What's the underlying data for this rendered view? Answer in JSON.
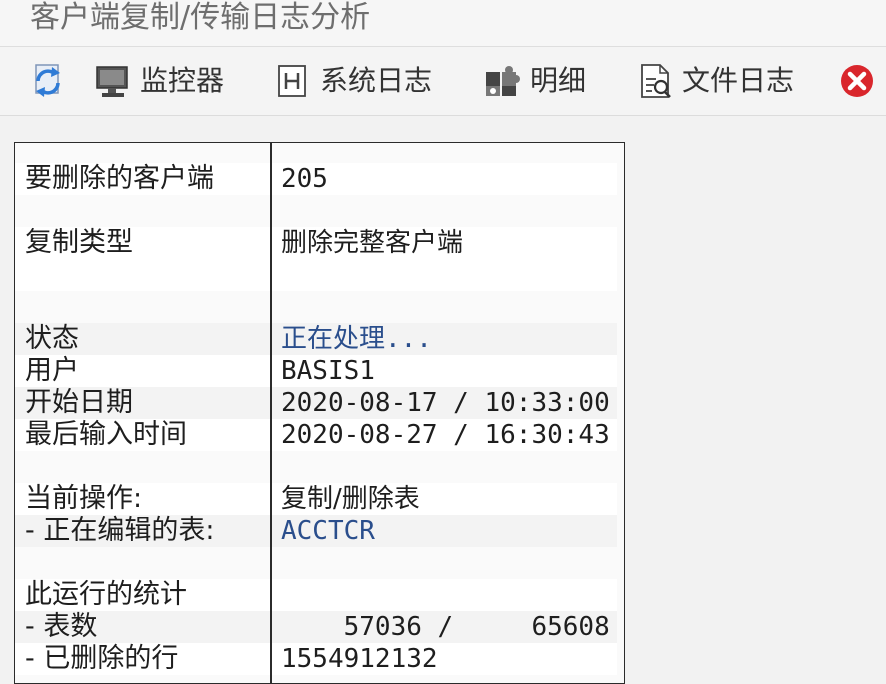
{
  "window": {
    "title": "客户端复制/传输日志分析"
  },
  "toolbar": {
    "refresh_icon": "refresh-icon",
    "monitor_label": "监控器",
    "syslog_label": "系统日志",
    "detail_label": "明细",
    "filelog_label": "文件日志",
    "close_icon": "close-icon"
  },
  "colors": {
    "close": "#d9262c",
    "value_blue": "#2a4e8c"
  },
  "log": {
    "client_label": "要删除的客户端",
    "client_value": "205",
    "copy_type_label": "复制类型",
    "copy_type_value": "删除完整客户端",
    "status_label": "状态",
    "status_value": "正在处理...",
    "user_label": "用户",
    "user_value": "BASIS1",
    "start_label": "开始日期",
    "start_value": "2020-08-17 / 10:33:00",
    "last_label": "最后输入时间",
    "last_value": "2020-08-27 / 16:30:43",
    "current_op_label": "当前操作:",
    "current_op_value": "复制/删除表",
    "editing_label": "- 正在编辑的表:",
    "editing_value": "ACCTCR",
    "stats_label": "此运行的统计",
    "tables_label": "- 表数",
    "tables_value": "    57036 /     65608",
    "deleted_label": "- 已删除的行",
    "deleted_value": "1554912132"
  }
}
